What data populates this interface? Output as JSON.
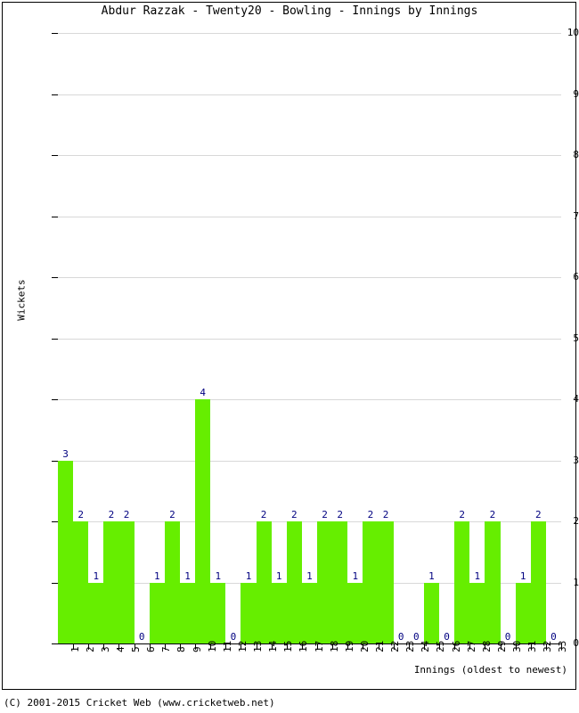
{
  "chart": {
    "title": "Abdur Razzak - Twenty20 - Bowling - Innings by Innings",
    "ylabel": "Wickets",
    "xlabel": "Innings (oldest to newest)",
    "bar_color": "#66ee00",
    "value_label_color": "#000080",
    "gridline_color": "#d8d8d8"
  },
  "footer": {
    "copyright": "(C) 2001-2015 Cricket Web (www.cricketweb.net)"
  },
  "chart_data": {
    "type": "bar",
    "title": "Abdur Razzak - Twenty20 - Bowling - Innings by Innings",
    "xlabel": "Innings (oldest to newest)",
    "ylabel": "Wickets",
    "ylim": [
      0,
      10
    ],
    "yticks": [
      0,
      1,
      2,
      3,
      4,
      5,
      6,
      7,
      8,
      9,
      10
    ],
    "grid": true,
    "legend": "none",
    "categories": [
      "1",
      "2",
      "3",
      "4",
      "5",
      "6",
      "7",
      "8",
      "9",
      "10",
      "11",
      "12",
      "13",
      "14",
      "15",
      "16",
      "17",
      "18",
      "19",
      "20",
      "21",
      "22",
      "23",
      "24",
      "25",
      "26",
      "27",
      "28",
      "29",
      "30",
      "31",
      "32",
      "33"
    ],
    "values": [
      3,
      2,
      1,
      2,
      2,
      0,
      1,
      2,
      1,
      4,
      1,
      0,
      1,
      2,
      1,
      2,
      1,
      2,
      2,
      1,
      2,
      2,
      0,
      0,
      1,
      0,
      2,
      1,
      2,
      0,
      1,
      2,
      0
    ]
  }
}
